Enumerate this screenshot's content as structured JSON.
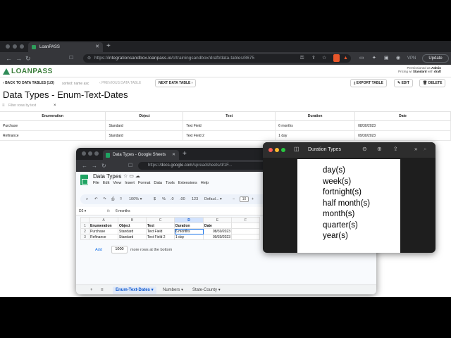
{
  "browser": {
    "tab_title": "LoanPASS",
    "url_prefix": "https://",
    "url_host": "integrationsandbox.loanpass.io",
    "url_path": "/c/trainingsandbox/draft/data-tables/8675",
    "vpn": "VPN",
    "update": "Update"
  },
  "app": {
    "logo_text": "LOANPASS",
    "user_line1_pre": "Permissioned as",
    "user_line1_bold": "Admin",
    "user_line2_pre": "Pricing w/",
    "user_line2_bold": "Standard",
    "user_line2_post": "with",
    "user_line2_end": "draft",
    "back_label": "BACK TO DATA TABLES (1/3)",
    "sort_info": "sorted: name asc",
    "prev_label": "PREVIOUS DATA TABLE",
    "next_label": "NEXT DATA TABLE",
    "export_label": "EXPORT TABLE",
    "edit_label": "EDIT",
    "delete_label": "DELETE",
    "title": "Data Types - Enum-Text-Dates",
    "filter_placeholder": "Filter rows by text",
    "columns": [
      "Enumeration",
      "Object",
      "Text",
      "Duration",
      "Date"
    ],
    "rows": [
      [
        "Purchase",
        "Standard",
        "Text Field",
        "6 months",
        "08/30/2023"
      ],
      [
        "Refinance",
        "Standard",
        "Text Field 2",
        "1 day",
        "09/30/2023"
      ]
    ]
  },
  "sheets": {
    "tab_title": "Data Types - Google Sheets",
    "url_prefix": "https://",
    "url_host": "docs.google.com",
    "url_path": "/spreadsheets/d/1F...",
    "doc_title": "Data Types",
    "menu": [
      "File",
      "Edit",
      "View",
      "Insert",
      "Format",
      "Data",
      "Tools",
      "Extensions",
      "Help"
    ],
    "zoom": "100%",
    "font": "Defaul...",
    "font_size": "10",
    "name_box": "D2",
    "formula_value": "6 months",
    "col_letters": [
      "A",
      "B",
      "C",
      "D",
      "E",
      "F"
    ],
    "row_numbers": [
      "1",
      "2",
      "3"
    ],
    "header_row": [
      "Enumeration",
      "Object",
      "Text",
      "Duration",
      "Date",
      ""
    ],
    "rows": [
      [
        "Purchase",
        "Standard",
        "Text Field",
        "6 months",
        "08/30/2023",
        ""
      ],
      [
        "Refinance",
        "Standard",
        "Text Field 2",
        "1 day",
        "09/30/2023",
        ""
      ]
    ],
    "add_label": "Add",
    "add_count": "1000",
    "add_suffix": "more rows at the bottom",
    "sheet_tabs": [
      "Enum-Text-Dates",
      "Numbers",
      "State-County"
    ]
  },
  "preview": {
    "title": "Duration Types",
    "lines": [
      "day(s)",
      "week(s)",
      "fortnight(s)",
      "half month(s)",
      "month(s)",
      "quarter(s)",
      "year(s)"
    ]
  },
  "colors": {
    "brand_green": "#2e8b57",
    "sheets_green": "#1ea362",
    "selection_blue": "#1a73e8"
  }
}
